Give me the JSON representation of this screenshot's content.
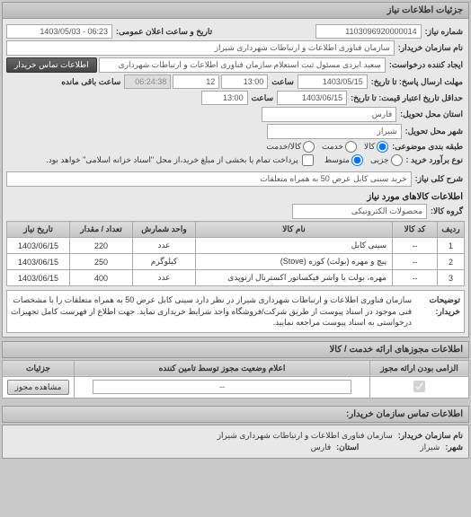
{
  "main_header": "جزئیات اطلاعات نیاز",
  "req_no_label": "شماره نیاز:",
  "req_no": "1103096920000014",
  "announce_label": "تاریخ و ساعت اعلان عمومی:",
  "announce": "06:23 - 1403/05/03",
  "buyer_label": "نام سازمان خریدار:",
  "buyer": "سازمان فناوری اطلاعات و ارتباطات شهرداری شیراز",
  "requester_label": "ایجاد کننده درخواست:",
  "requester": "سعید ایزدی مسئول ثبت استعلام سازمان فناوری اطلاعات و ارتباطات شهرداری",
  "contact_btn": "اطلاعات تماس خریدار",
  "deadline_reply_label": "مهلت ارسال پاسخ: تا تاریخ:",
  "deadline_reply_date": "1403/05/15",
  "time_label": "ساعت",
  "deadline_reply_time": "13:00",
  "remaining_days": "12",
  "remaining_time": "06:24:38",
  "remaining_suffix": "ساعت باقی مانده",
  "validity_label": "حداقل تاریخ اعتبار قیمت: تا تاریخ:",
  "validity_date": "1403/06/15",
  "validity_time": "13:00",
  "province_label": "استان محل تحویل:",
  "province": "فارس",
  "city_label": "شهر محل تحویل:",
  "city": "شیراز",
  "group_type_label": "طبقه بندی موضوعی:",
  "group_opts": {
    "r1": "کالا",
    "r2": "خدمت",
    "r3": "کالا/خدمت"
  },
  "need_type_label": "نوع برآورد خرید :",
  "need_opts": {
    "r1": "جزیی",
    "r2": "متوسط"
  },
  "need_note": "پرداخت تمام یا بخشی از مبلغ خرید،از محل \"اسناد خزانه اسلامی\" خواهد بود.",
  "need_note_chk_label": "",
  "title_label": "شرح کلی نیاز:",
  "title": "خرید سینی کابل عرض 50 به همراه متعلقات",
  "goods_header": "اطلاعات کالاهای مورد نیاز",
  "goods_group_label": "گروه کالا:",
  "goods_group": "محصولات الکترونیکی",
  "cols": {
    "idx": "ردیف",
    "code": "کد کالا",
    "name": "نام کالا",
    "unit": "واحد شمارش",
    "qty": "تعداد / مقدار",
    "date": "تاریخ نیاز"
  },
  "rows": [
    {
      "idx": "1",
      "code": "--",
      "name": "سینی کابل",
      "unit": "عدد",
      "qty": "220",
      "date": "1403/06/15"
    },
    {
      "idx": "2",
      "code": "--",
      "name": "پیچ و مهره (بولت) کوره (Stove)",
      "unit": "کیلوگرم",
      "qty": "250",
      "date": "1403/06/15"
    },
    {
      "idx": "3",
      "code": "--",
      "name": "مهره، بولت یا واشر فیکساتور اکسترنال ارتوپدی",
      "unit": "عدد",
      "qty": "400",
      "date": "1403/06/15"
    }
  ],
  "desc_label": "توضیحات خریدار:",
  "desc": "سازمان فناوری اطلاعات و ارتباطات شهرداری شیراز در نظر دارد سینی کابل عرض 50 به همراه متعلقات را با مشخصات فنی موجود در اسناد پیوست از طریق شرکت/فروشگاه واجد شرایط خریداری نماید. جهت اطلاع از فهرست کامل تجهیزات درخواستی به اسناد پیوست مراجعه نمایید.",
  "license_header": "اطلاعات مجوزهای ارائه خدمت / کالا",
  "lic_cols": {
    "mandatory": "الزامی بودن ارائه مجوز",
    "status": "اعلام وضعیت مجوز توسط تامین کننده",
    "ops": "جزئیات"
  },
  "lic_row": {
    "mandatory_chk": "",
    "status": "--",
    "op": "مشاهده مجوز"
  },
  "contact_header": "اطلاعات تماس سازمان خریدار:",
  "c_org_label": "نام سازمان خریدار:",
  "c_org": "سازمان فناوری اطلاعات و ارتباطات شهرداری شیراز",
  "c_city_label": "شهر:",
  "c_city": "شیراز",
  "c_prov_label": "استان:",
  "c_prov": "فارس"
}
